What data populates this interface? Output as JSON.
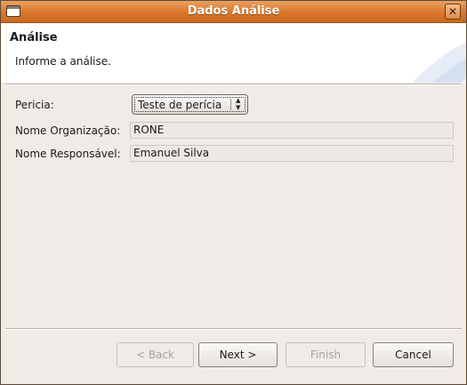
{
  "window": {
    "title": "Dados Análise",
    "close_label": "✕"
  },
  "header": {
    "title": "Análise",
    "description": "Informe a análise."
  },
  "form": {
    "pericia_label": "Pericia:",
    "pericia_value": "Teste de perícia",
    "org_label": "Nome Organização:",
    "org_value": "RONE",
    "resp_label": "Nome Responsável:",
    "resp_value": "Emanuel Silva"
  },
  "buttons": {
    "back_label": "< Back",
    "next_label": "Next >",
    "finish_label": "Finish",
    "cancel_label": "Cancel"
  }
}
